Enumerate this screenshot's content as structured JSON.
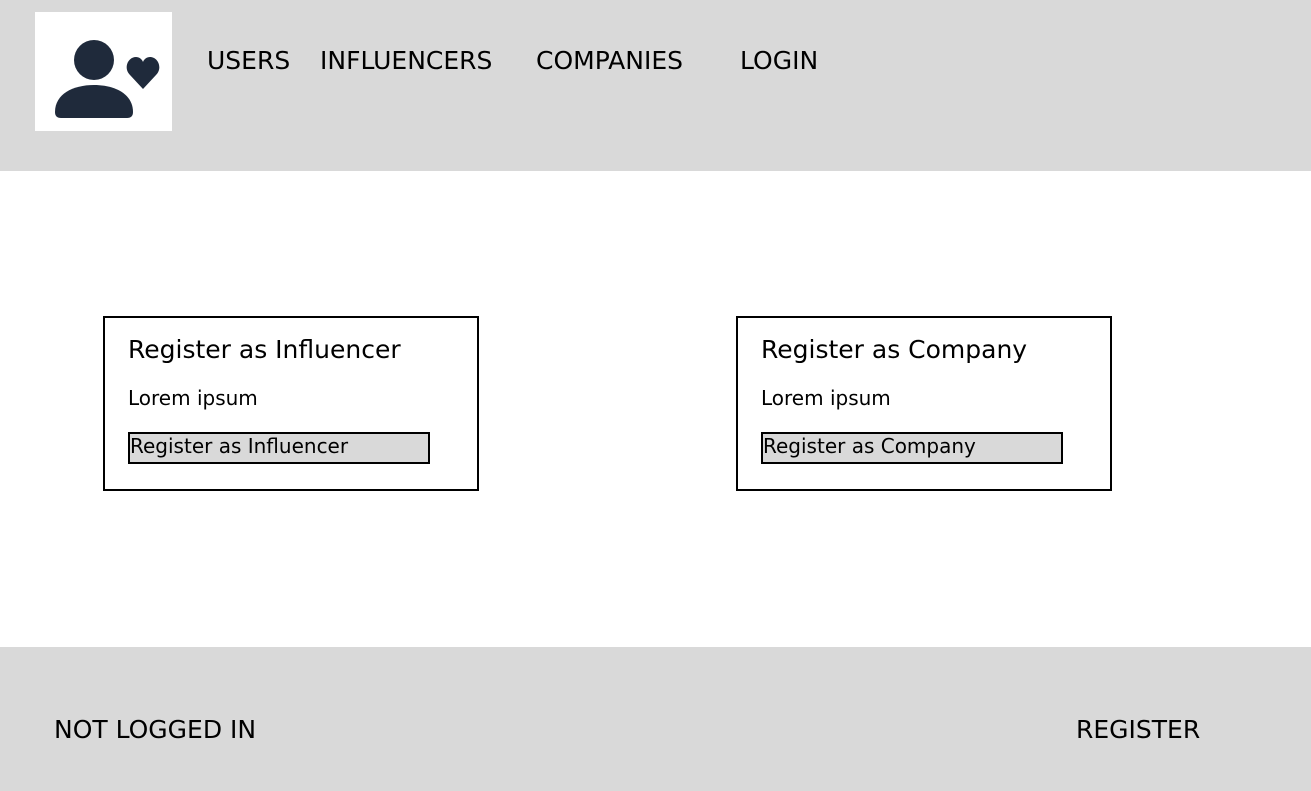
{
  "header": {
    "logo_icon": "user-heart-icon",
    "nav": {
      "users": "USERS",
      "influencers": "INFLUENCERS",
      "companies": "COMPANIES",
      "login": "LOGIN"
    }
  },
  "cards": {
    "influencer": {
      "title": "Register as Influencer",
      "text": "Lorem ipsum",
      "button": "Register as Influencer"
    },
    "company": {
      "title": "Register as Company",
      "text": "Lorem ipsum",
      "button": "Register as Company"
    }
  },
  "footer": {
    "status": "NOT LOGGED IN",
    "register": "REGISTER"
  },
  "colors": {
    "bar_background": "#d9d9d9",
    "icon": "#1f2a3b"
  }
}
